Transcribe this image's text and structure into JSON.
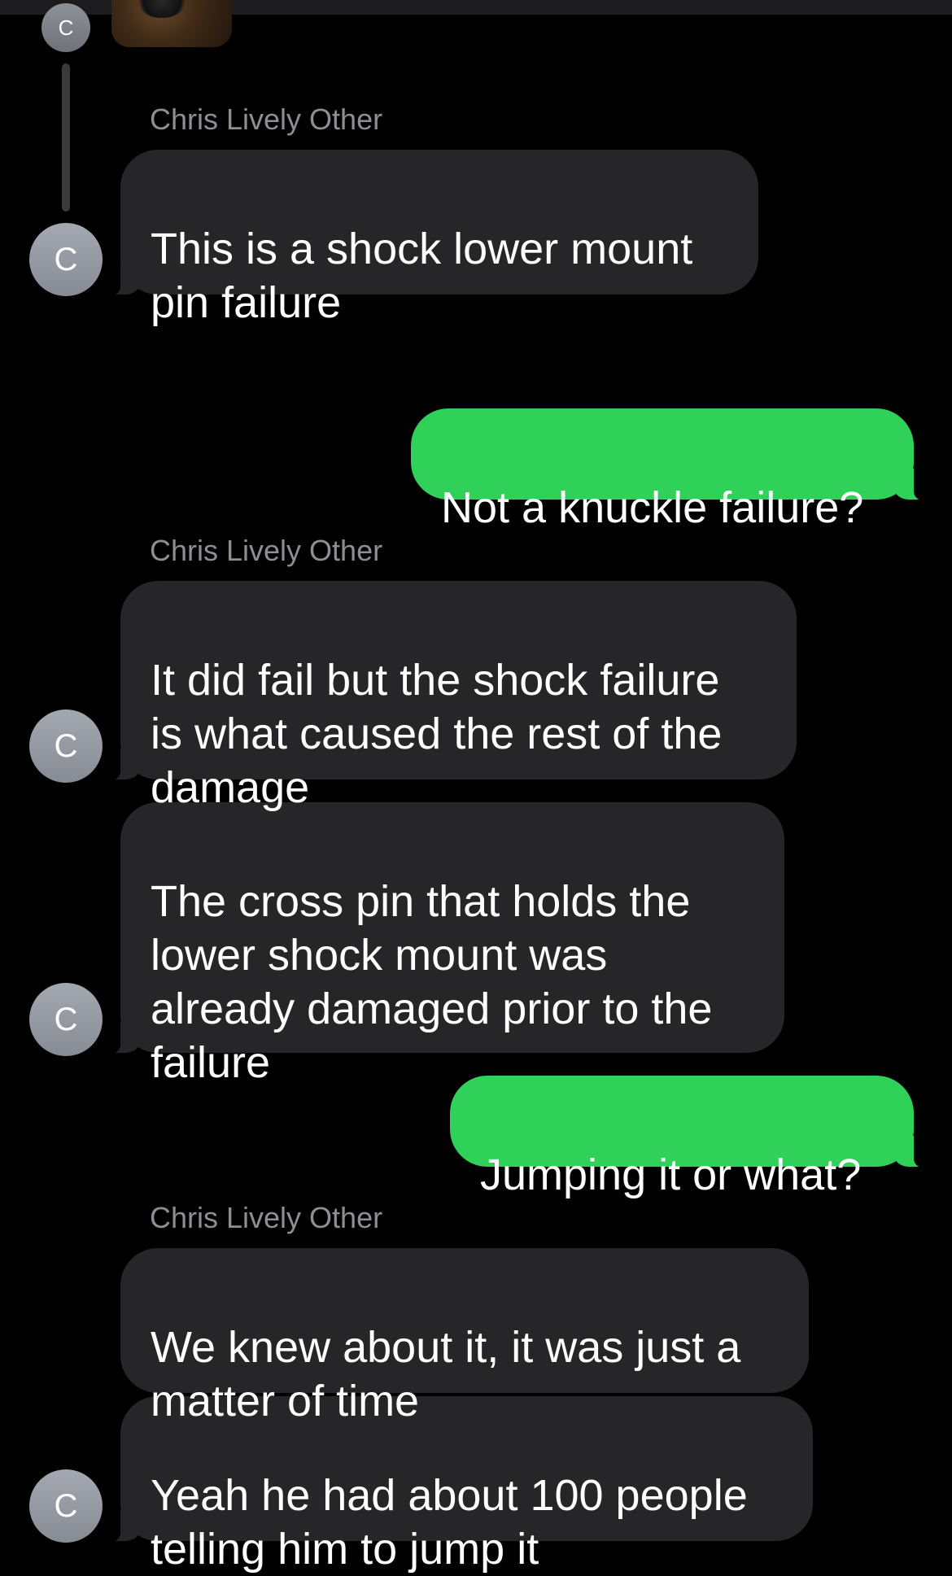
{
  "avatar_initial": "C",
  "messages": [
    {
      "direction": "in",
      "sender": "Chris Lively Other",
      "text": "This is a shock lower mount\npin failure"
    },
    {
      "direction": "out",
      "text": "Not a knuckle failure?"
    },
    {
      "direction": "in",
      "sender": "Chris Lively Other",
      "text": "It did fail but the shock failure\nis what caused the rest of the\ndamage"
    },
    {
      "direction": "in",
      "text": "The cross pin that holds the\nlower shock mount was\nalready damaged prior to the\nfailure"
    },
    {
      "direction": "out",
      "text": "Jumping it or what?"
    },
    {
      "direction": "in",
      "sender": "Chris Lively Other",
      "text": "We knew about it, it was just a\nmatter of time"
    },
    {
      "direction": "in",
      "text": "Yeah he had about 100 people\ntelling him to jump it"
    }
  ]
}
